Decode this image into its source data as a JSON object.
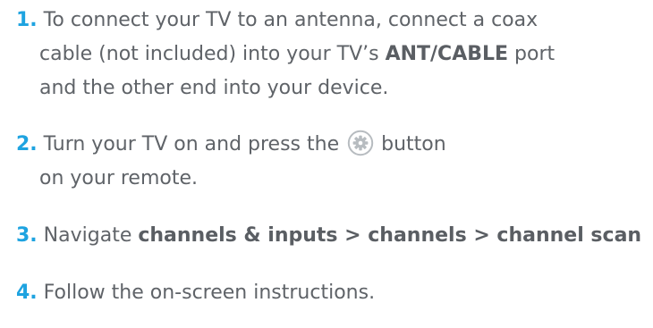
{
  "steps": [
    {
      "number": "1.",
      "lines": [
        [
          "To connect your TV to an antenna, connect a coax"
        ],
        [
          "cable (not included) into your TV’s ",
          "ANT/CABLE",
          " port"
        ],
        [
          "and the other end into your device."
        ]
      ]
    },
    {
      "number": "2.",
      "before_icon": "Turn your TV on and press the ",
      "icon": "gear-icon",
      "after_icon": " button",
      "line2": "on your remote."
    },
    {
      "number": "3.",
      "text": "Navigate ",
      "path": "channels & inputs > channels > channel scan"
    },
    {
      "number": "4.",
      "text": "Follow the on-screen instructions."
    }
  ],
  "colors": {
    "accent": "#1ea3e0",
    "text": "#5f6368",
    "icon": "#b7bcc0"
  }
}
